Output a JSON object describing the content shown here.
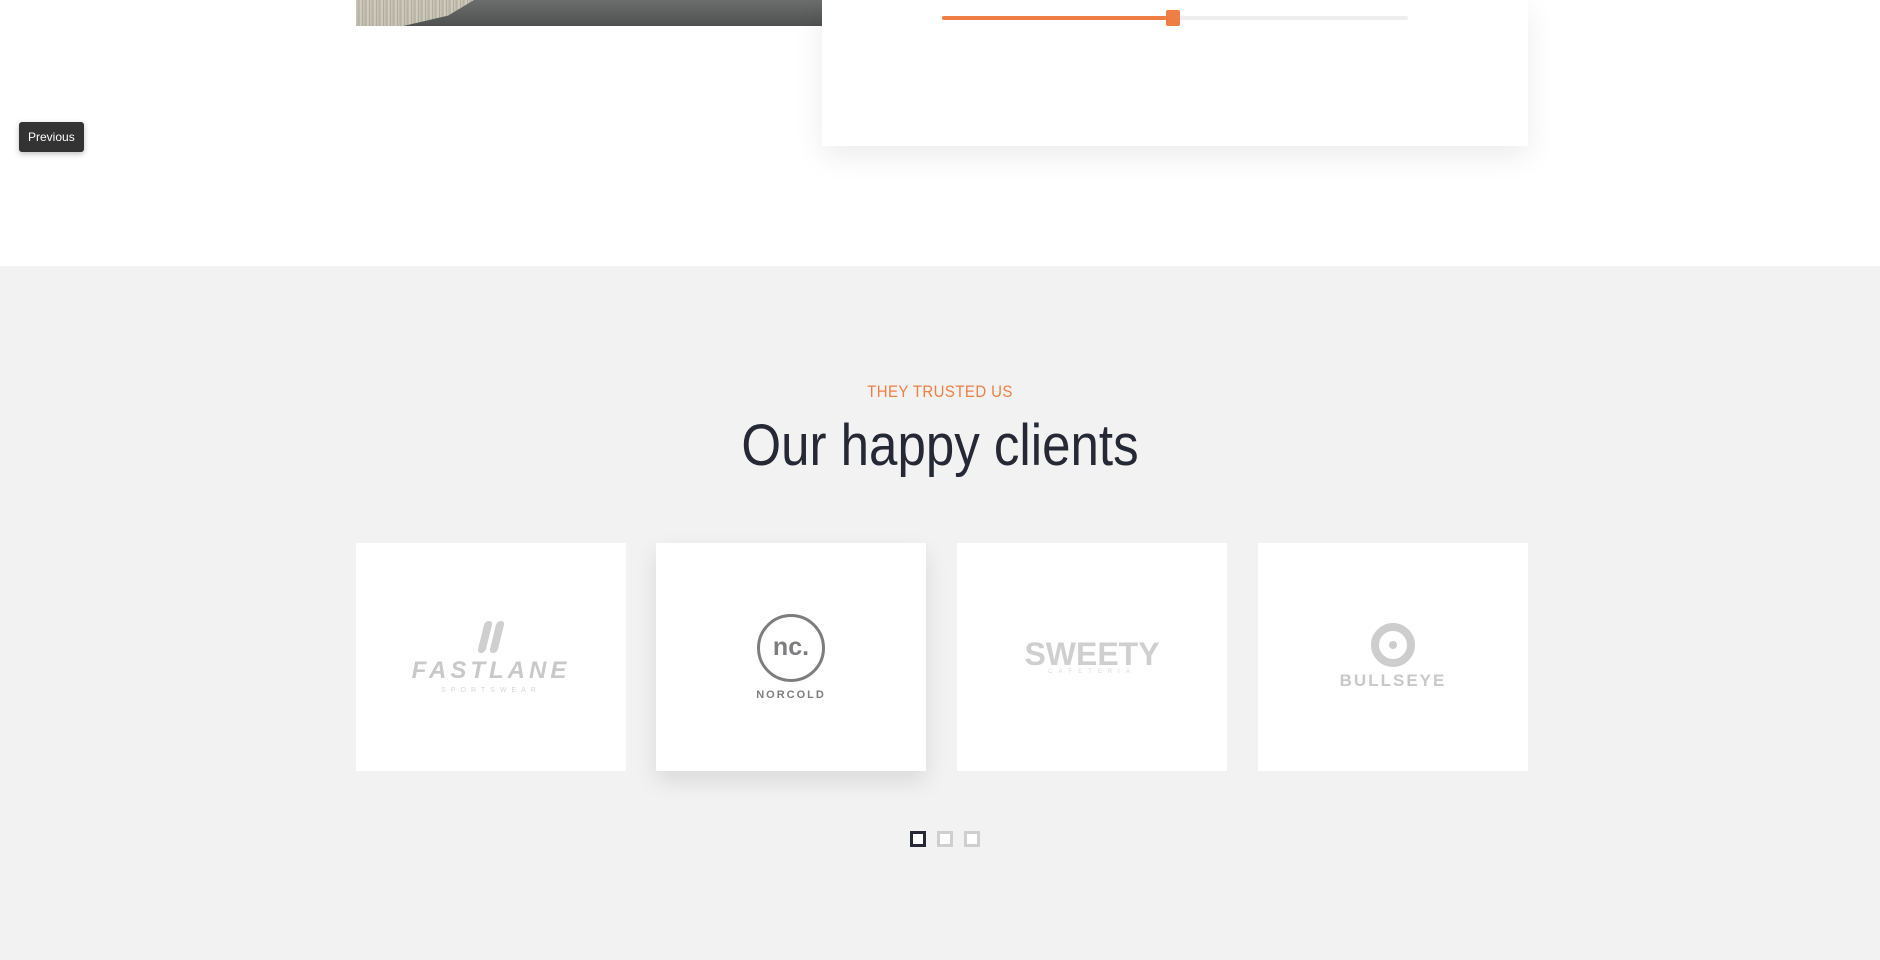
{
  "slider": {
    "value_fraction": 0.495,
    "accent_color": "#ee7e44"
  },
  "tooltip": {
    "label": "Previous"
  },
  "clients": {
    "eyebrow": "THEY TRUSTED US",
    "title": "Our happy clients",
    "logos": [
      {
        "name": "FASTLANE",
        "tagline": "SPORTSWEAR",
        "icon": "fastlane-logo"
      },
      {
        "name": "NORCOLD",
        "mark": "nc.",
        "icon": "norcold-logo"
      },
      {
        "name": "SWEETY",
        "tagline": "CAFETERIA",
        "icon": "sweety-logo"
      },
      {
        "name": "BULLSEYE",
        "icon": "bullseye-logo"
      }
    ],
    "pagination": {
      "count": 3,
      "active": 1
    }
  },
  "colors": {
    "accent": "#ee7e44",
    "dark": "#262935",
    "section_bg": "#f2f2f2"
  }
}
